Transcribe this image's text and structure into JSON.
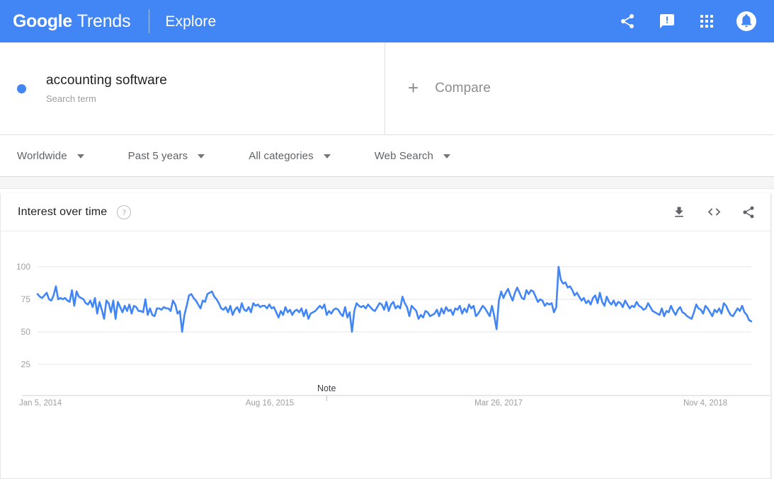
{
  "appbar": {
    "brand_google": "Google",
    "brand_trends": "Trends",
    "explore": "Explore",
    "actions": [
      {
        "name": "share-icon",
        "label": "Share"
      },
      {
        "name": "feedback-icon",
        "label": "Send feedback"
      },
      {
        "name": "apps-grid-icon",
        "label": "Google apps"
      },
      {
        "name": "notifications-bell-icon",
        "label": "Notifications"
      }
    ],
    "background_color": "#4285f4"
  },
  "terms": {
    "items": [
      {
        "title": "accounting software",
        "subtitle": "Search term",
        "color": "#4285f4"
      }
    ],
    "compare_label": "Compare",
    "compare_plus": "+"
  },
  "filters": [
    {
      "label": "Worldwide"
    },
    {
      "label": "Past 5 years"
    },
    {
      "label": "All categories"
    },
    {
      "label": "Web Search"
    }
  ],
  "card": {
    "title": "Interest over time",
    "help_glyph": "?",
    "tools": [
      {
        "name": "download-icon",
        "label": "Download CSV"
      },
      {
        "name": "embed-code-icon",
        "label": "Embed"
      },
      {
        "name": "share-icon",
        "label": "Share"
      }
    ]
  },
  "chart_data": {
    "type": "line",
    "title": "Interest over time",
    "xlabel": "",
    "ylabel": "",
    "ylim": [
      0,
      100
    ],
    "yticks": [
      100,
      75,
      50,
      25
    ],
    "ytick_labels": [
      "100",
      "75",
      "50",
      "25"
    ],
    "xtick_labels": [
      "Jan 5, 2014",
      "Aug 16, 2015",
      "Mar 26, 2017",
      "Nov 4, 2018"
    ],
    "grid": true,
    "legend": "none",
    "line_color": "#4285f4",
    "annotations": [
      {
        "label": "Note",
        "x_fraction": 0.405
      }
    ],
    "series": [
      {
        "name": "accounting software",
        "color": "#4285f4",
        "values": [
          79,
          77,
          76,
          78,
          80,
          75,
          74,
          78,
          85,
          75,
          76,
          75,
          76,
          74,
          73,
          82,
          70,
          81,
          77,
          76,
          75,
          72,
          71,
          74,
          69,
          76,
          64,
          73,
          67,
          60,
          74,
          72,
          65,
          74,
          60,
          73,
          69,
          65,
          70,
          66,
          71,
          64,
          70,
          69,
          66,
          66,
          65,
          75,
          63,
          68,
          63,
          62,
          68,
          68,
          67,
          69,
          68,
          68,
          66,
          74,
          71,
          64,
          66,
          50,
          63,
          70,
          78,
          79,
          76,
          74,
          71,
          68,
          74,
          73,
          79,
          80,
          81,
          77,
          75,
          72,
          68,
          67,
          69,
          65,
          70,
          63,
          67,
          69,
          65,
          72,
          67,
          66,
          69,
          65,
          72,
          70,
          71,
          69,
          70,
          70,
          68,
          71,
          68,
          69,
          65,
          61,
          66,
          63,
          69,
          65,
          67,
          63,
          66,
          67,
          65,
          68,
          62,
          67,
          60,
          64,
          65,
          66,
          68,
          70,
          68,
          71,
          63,
          66,
          64,
          67,
          68,
          67,
          64,
          62,
          69,
          61,
          65,
          50,
          66,
          72,
          70,
          69,
          70,
          68,
          71,
          69,
          67,
          66,
          69,
          72,
          71,
          67,
          73,
          66,
          71,
          73,
          68,
          70,
          68,
          77,
          72,
          69,
          62,
          70,
          68,
          66,
          60,
          63,
          61,
          66,
          65,
          62,
          63,
          64,
          67,
          62,
          68,
          64,
          69,
          66,
          67,
          63,
          68,
          67,
          70,
          64,
          68,
          65,
          71,
          68,
          70,
          62,
          64,
          67,
          70,
          68,
          65,
          62,
          70,
          62,
          52,
          74,
          81,
          76,
          80,
          83,
          78,
          74,
          80,
          84,
          80,
          76,
          75,
          82,
          79,
          82,
          81,
          77,
          73,
          75,
          74,
          70,
          72,
          71,
          72,
          65,
          69,
          100,
          90,
          87,
          88,
          84,
          85,
          82,
          78,
          80,
          77,
          74,
          76,
          72,
          74,
          71,
          76,
          78,
          72,
          80,
          73,
          70,
          77,
          73,
          71,
          74,
          70,
          73,
          72,
          69,
          74,
          71,
          68,
          70,
          69,
          73,
          70,
          69,
          67,
          68,
          72,
          69,
          66,
          65,
          64,
          63,
          68,
          62,
          66,
          65,
          70,
          66,
          63,
          67,
          69,
          65,
          64,
          62,
          61,
          60,
          65,
          71,
          68,
          67,
          64,
          70,
          68,
          65,
          62,
          67,
          65,
          68,
          64,
          72,
          70,
          66,
          63,
          62,
          65,
          68,
          66,
          70,
          65,
          63,
          59,
          58
        ]
      }
    ]
  }
}
